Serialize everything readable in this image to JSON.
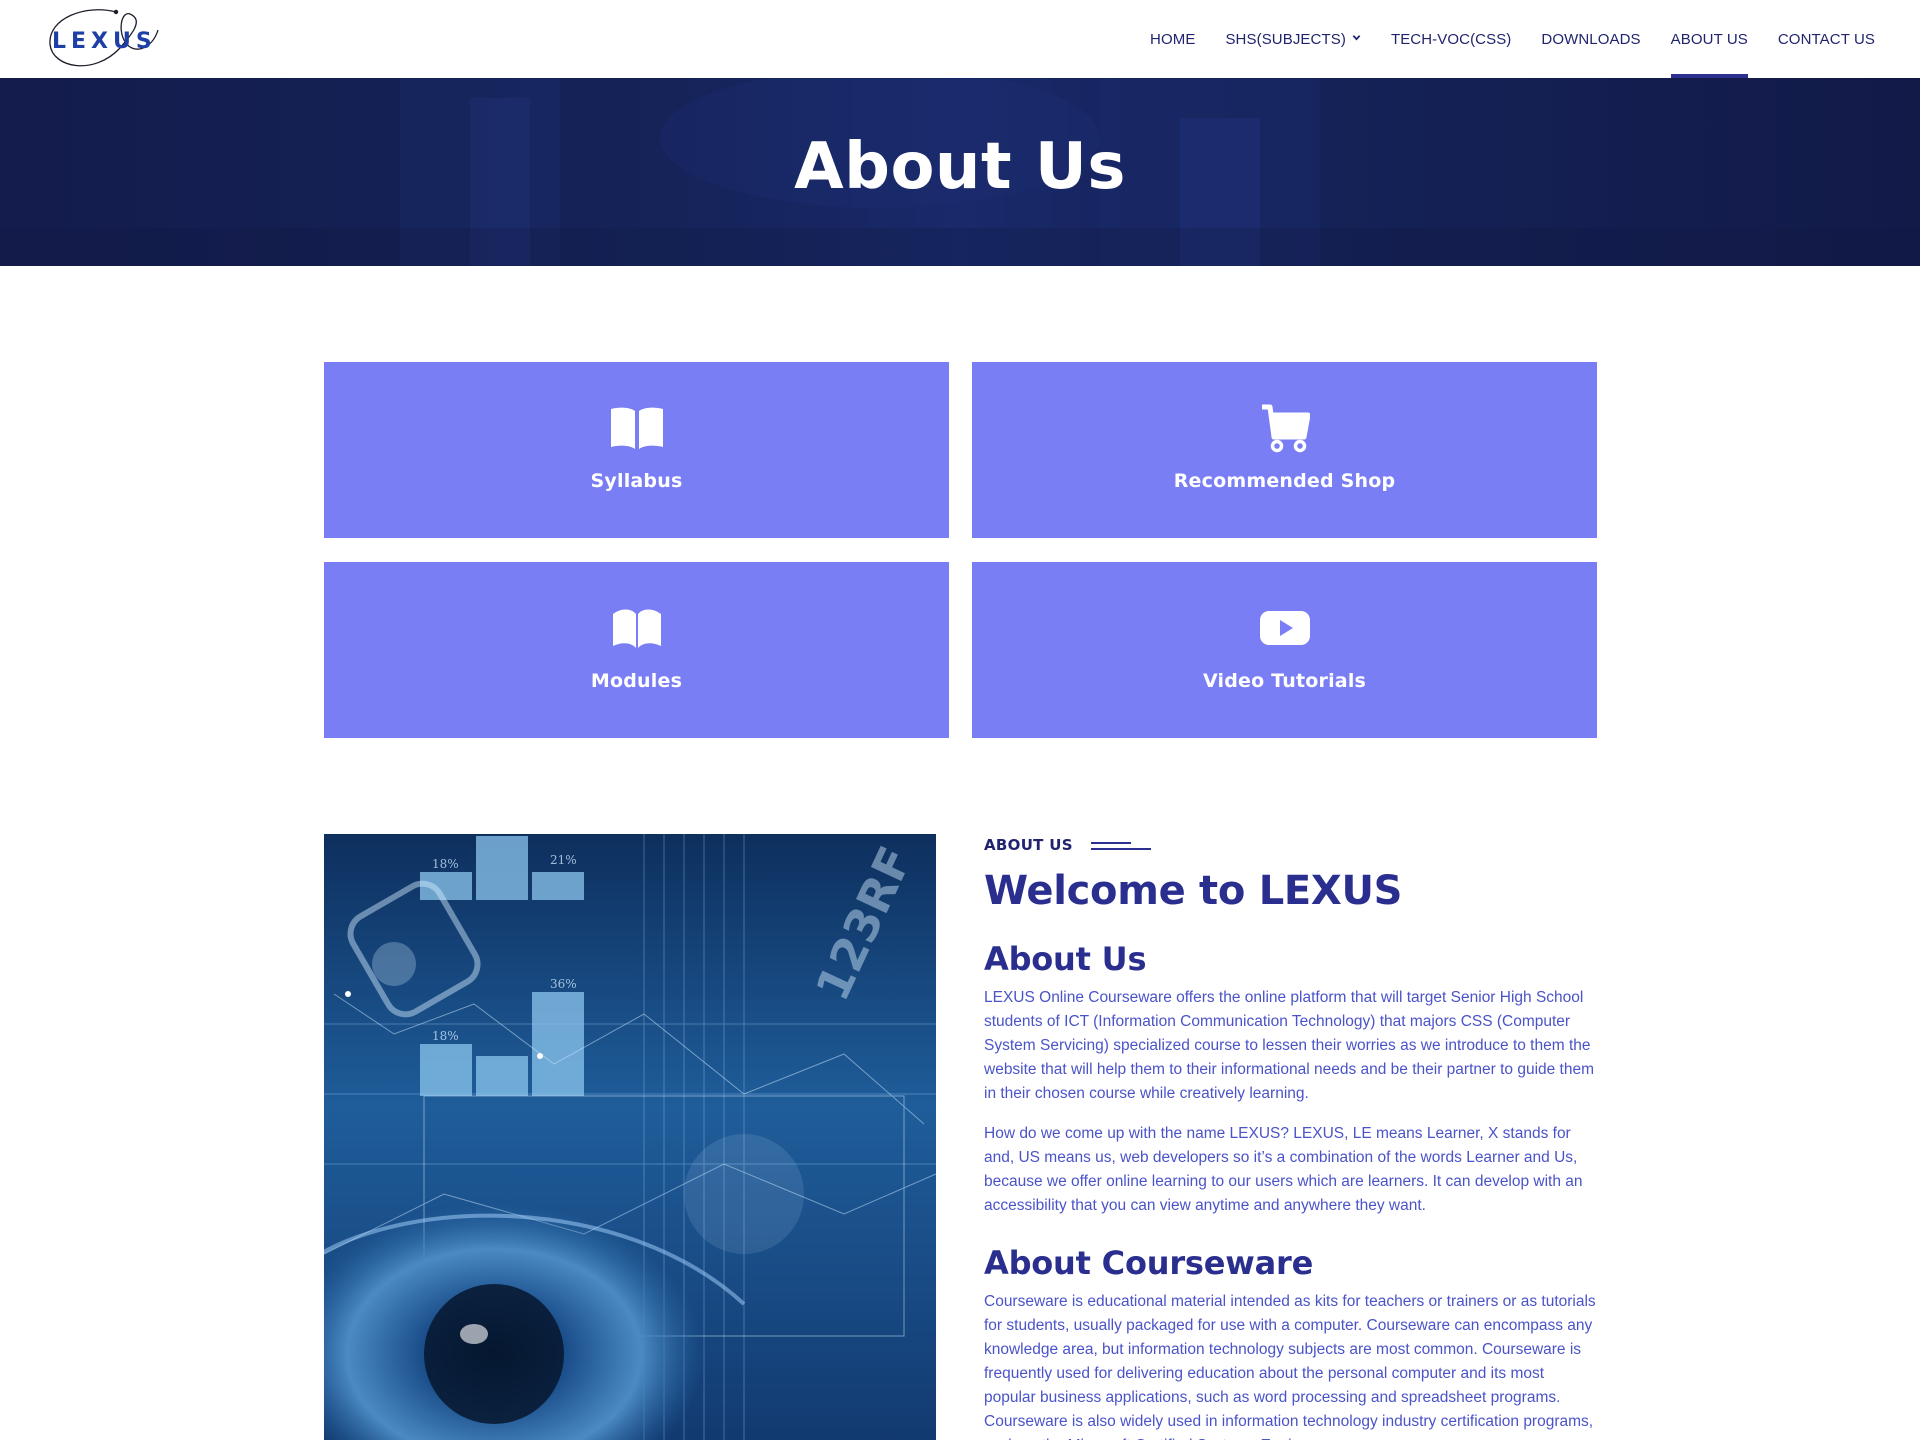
{
  "header": {
    "logo_text": "LEXUS",
    "nav": [
      {
        "label": "HOME"
      },
      {
        "label": "SHS(SUBJECTS)"
      },
      {
        "label": "TECH-VOC(CSS)"
      },
      {
        "label": "DOWNLOADS"
      },
      {
        "label": "ABOUT US"
      },
      {
        "label": "CONTACT US"
      }
    ],
    "active_nav": "ABOUT US"
  },
  "hero": {
    "title": "About Us"
  },
  "cards": [
    {
      "label": "Syllabus",
      "icon": "open-book-icon"
    },
    {
      "label": "Recommended Shop",
      "icon": "shopping-cart-icon"
    },
    {
      "label": "Modules",
      "icon": "book-open-icon"
    },
    {
      "label": "Video Tutorials",
      "icon": "youtube-play-icon"
    }
  ],
  "about": {
    "eyebrow": "ABOUT US",
    "title": "Welcome to LEXUS",
    "sections": [
      {
        "heading": "About Us",
        "paragraphs": [
          "LEXUS Online Courseware offers the online platform that will target Senior High School students of ICT (Information Communication Technology) that majors CSS (Computer System Servicing) specialized course to lessen their worries as we introduce to them the website that will help them to their informational needs and be their partner to guide them in their chosen course while creatively learning.",
          "How do we come up with the name LEXUS? LEXUS, LE means Learner, X stands for and, US means us, web developers so it’s a combination of the words Learner and Us, because we offer online learning to our users which are learners. It can develop with an accessibility that you can view anytime and anywhere they want."
        ]
      },
      {
        "heading": "About Courseware",
        "paragraphs": [
          "Courseware is educational material intended as kits for teachers or trainers or as tutorials for students, usually packaged for use with a computer. Courseware can encompass any knowledge area, but information technology subjects are most common. Courseware is frequently used for delivering education about the personal computer and its most popular business applications, such as word processing and spreadsheet programs. Courseware is also widely used in information technology industry certification programs, such as the Microsoft Certified Systems Engineer"
        ]
      }
    ]
  },
  "image": {
    "description_icon": "digital-eye-image",
    "chart_labels": [
      "18%",
      "21%",
      "36%",
      "18%"
    ],
    "watermark": "123RF"
  },
  "colors": {
    "nav_text": "#20246e",
    "hero_bg": "#152359",
    "card_bg": "#7a7ef5",
    "heading": "#2a2f8f",
    "body_text": "#4a53c9"
  }
}
